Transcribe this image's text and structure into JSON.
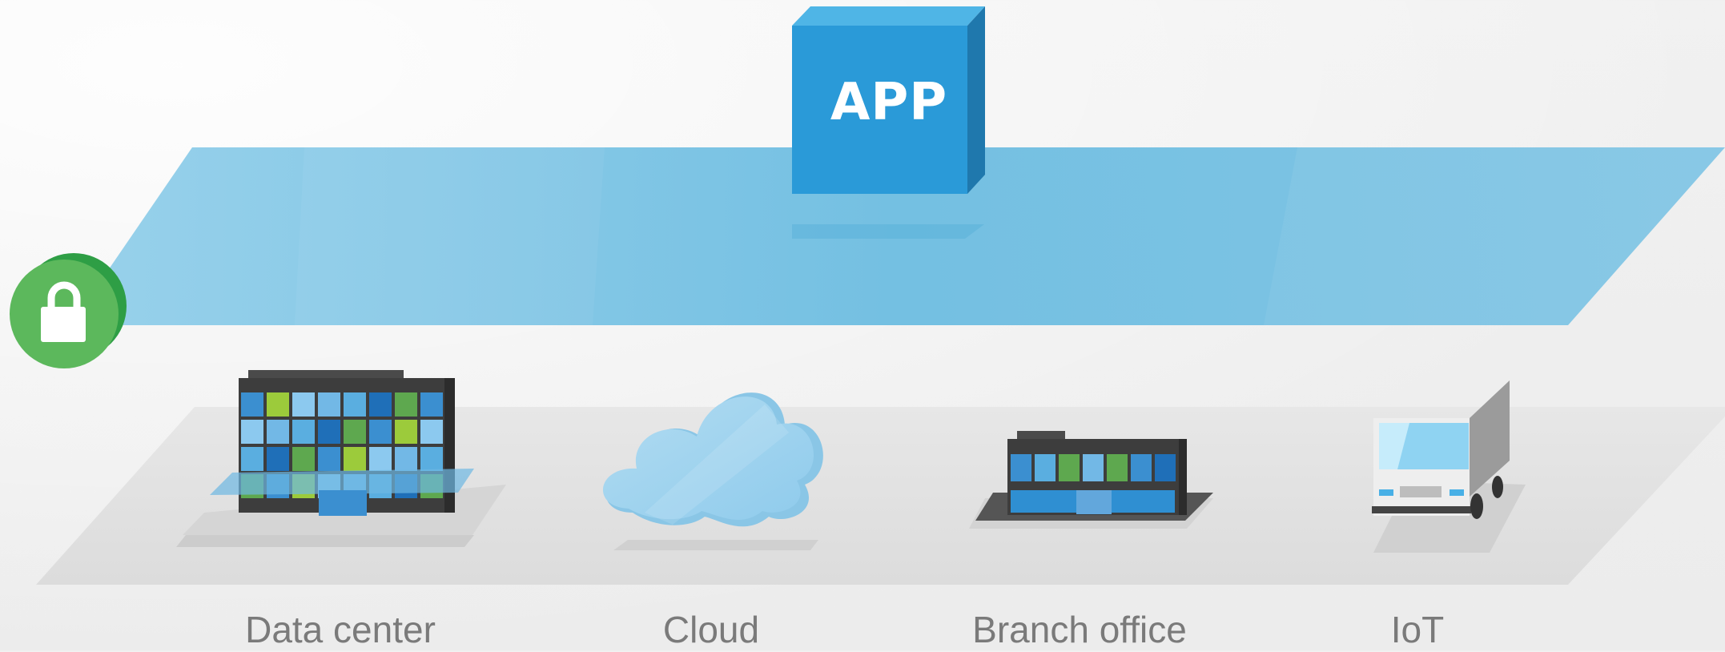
{
  "app": {
    "label": "APP"
  },
  "sites": [
    {
      "label": "Data center"
    },
    {
      "label": "Cloud"
    },
    {
      "label": "Branch office"
    },
    {
      "label": "IoT"
    }
  ],
  "icons": [
    "lock-icon",
    "data-center-building-icon",
    "cloud-icon",
    "branch-office-building-icon",
    "iot-van-icon"
  ],
  "colors": {
    "overlay_plane": "#6dbde1",
    "app_cube": "#2a9ad8",
    "lock_badge": "#5cb85c",
    "ground_plane": "#e2e2e2",
    "label_text": "#7a7a7a"
  }
}
